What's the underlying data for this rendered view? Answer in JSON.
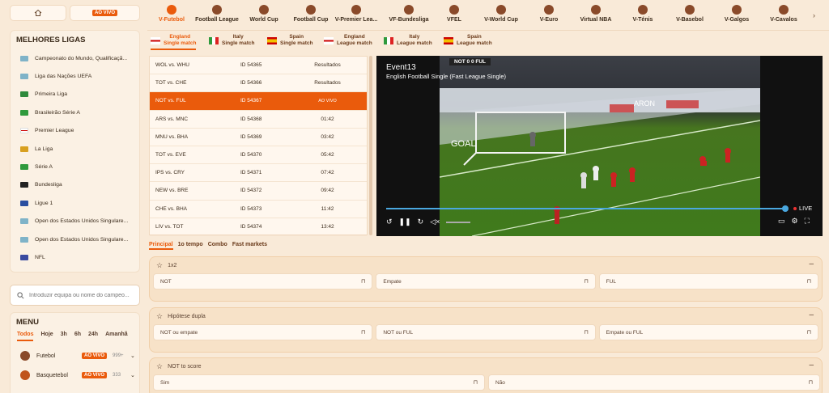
{
  "sidebar": {
    "live_label": "AO VIVO",
    "leagues_title": "MELHORES LIGAS",
    "leagues": [
      {
        "label": "Campeonato do Mundo, Qualificaçã...",
        "flag": "#7fb3c8"
      },
      {
        "label": "Liga das Nações UEFA",
        "flag": "#7fb3c8"
      },
      {
        "label": "Primeira Liga",
        "flag": "#2f8a3c"
      },
      {
        "label": "Brasileirão Série A",
        "flag": "#2f9a3c"
      },
      {
        "label": "Premier League",
        "flag": "#ffffff"
      },
      {
        "label": "La Liga",
        "flag": "#d8a020"
      },
      {
        "label": "Série A",
        "flag": "#2f9a3c"
      },
      {
        "label": "Bundesliga",
        "flag": "#222222"
      },
      {
        "label": "Ligue 1",
        "flag": "#2a4ea0"
      },
      {
        "label": "Open dos Estados Unidos Singulare...",
        "flag": "#7fb3c8"
      },
      {
        "label": "Open dos Estados Unidos Singulare...",
        "flag": "#7fb3c8"
      },
      {
        "label": "NFL",
        "flag": "#3a4aa0"
      }
    ],
    "search_placeholder": "Introduzir equipa ou nome do campeo...",
    "menu_title": "MENU",
    "menu_tabs": [
      "Todos",
      "Hoje",
      "3h",
      "6h",
      "24h",
      "Amanhã"
    ],
    "sports": [
      {
        "label": "Futebol",
        "badge": "AO VIVO",
        "count": "999+"
      },
      {
        "label": "Basquetebol",
        "badge": "AO VIVO",
        "count": "333"
      }
    ]
  },
  "topnav": {
    "items": [
      "V-Futebol",
      "Football League",
      "World Cup",
      "Football Cup",
      "V-Premier Lea...",
      "VF-Bundesliga",
      "VFEL",
      "V-World Cup",
      "V-Euro",
      "Virtual NBA",
      "V-Ténis",
      "V-Basebol",
      "V-Galgos",
      "V-Cavalos"
    ]
  },
  "subtabs": [
    {
      "line1": "England",
      "line2": "Single match"
    },
    {
      "line1": "Italy",
      "line2": "Single match"
    },
    {
      "line1": "Spain",
      "line2": "Single match"
    },
    {
      "line1": "England",
      "line2": "League match"
    },
    {
      "line1": "Italy",
      "line2": "League match"
    },
    {
      "line1": "Spain",
      "line2": "League match"
    }
  ],
  "matches": [
    {
      "teams": "WOL vs. WHU",
      "id": "ID 54365",
      "status": "Resultados"
    },
    {
      "teams": "TOT vs. CHE",
      "id": "ID 54366",
      "status": "Resultados"
    },
    {
      "teams": "NOT vs. FUL",
      "id": "ID 54367",
      "status": "AO VIVO"
    },
    {
      "teams": "ARS vs. MNC",
      "id": "ID 54368",
      "status": "01:42"
    },
    {
      "teams": "MNU vs. BHA",
      "id": "ID 54369",
      "status": "03:42"
    },
    {
      "teams": "TOT vs. EVE",
      "id": "ID 54370",
      "status": "05:42"
    },
    {
      "teams": "IPS vs. CRY",
      "id": "ID 54371",
      "status": "07:42"
    },
    {
      "teams": "NEW vs. BRE",
      "id": "ID 54372",
      "status": "09:42"
    },
    {
      "teams": "CHE vs. BHA",
      "id": "ID 54373",
      "status": "11:42"
    },
    {
      "teams": "LIV vs. TOT",
      "id": "ID 54374",
      "status": "13:42"
    }
  ],
  "video": {
    "event_title": "Event13",
    "event_subtitle": "English Football Single (Fast League Single)",
    "scoreboard": "NOT 0 0 FUL",
    "live_label": "LIVE",
    "board_text_1": "GOAL",
    "board_text_2": "ARON",
    "progress": 1.0
  },
  "market_tabs": [
    "Principal",
    "1o tempo",
    "Combo",
    "Fast markets"
  ],
  "markets": [
    {
      "title": "1x2",
      "odds": [
        "NOT",
        "Empate",
        "FUL"
      ]
    },
    {
      "title": "Hipótese dupla",
      "odds": [
        "NOT ou empate",
        "NOT ou FUL",
        "Empate ou FUL"
      ]
    },
    {
      "title": "NOT to score",
      "odds": [
        "Sim",
        "Não"
      ]
    }
  ],
  "colors": {
    "accent": "#ea5b0c",
    "background": "#f9ead8"
  }
}
